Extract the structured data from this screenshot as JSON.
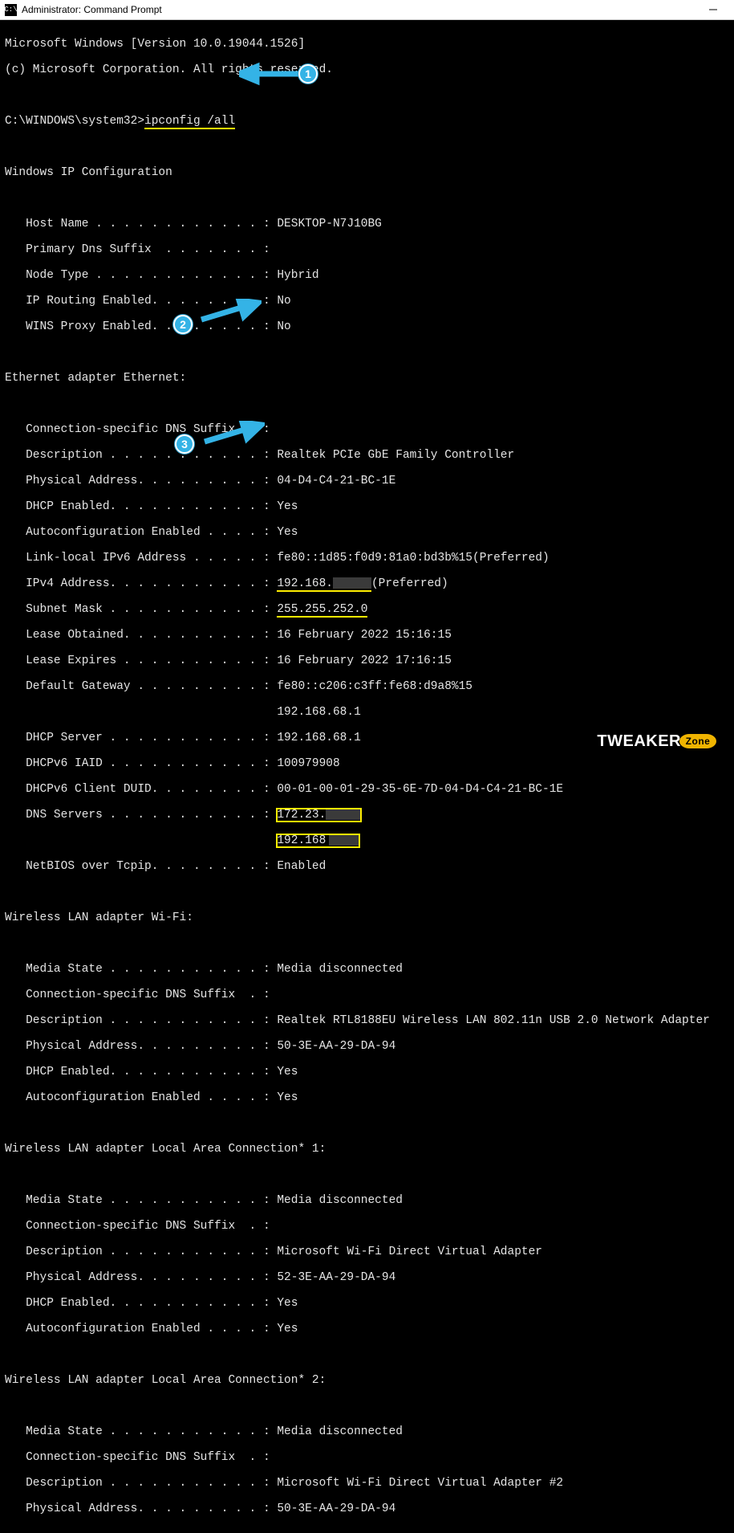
{
  "titlebar": {
    "icon_glyph": "C:\\",
    "title": "Administrator: Command Prompt"
  },
  "header": {
    "line1": "Microsoft Windows [Version 10.0.19044.1526]",
    "line2": "(c) Microsoft Corporation. All rights reserved."
  },
  "prompt": {
    "path": "C:\\WINDOWS\\system32>",
    "command": "ipconfig /all"
  },
  "ipcfg": {
    "heading": "Windows IP Configuration",
    "lines": [
      {
        "k": "   Host Name . . . . . . . . . . . . : ",
        "v": "DESKTOP-N7J10BG"
      },
      {
        "k": "   Primary Dns Suffix  . . . . . . . :",
        "v": ""
      },
      {
        "k": "   Node Type . . . . . . . . . . . . : ",
        "v": "Hybrid"
      },
      {
        "k": "   IP Routing Enabled. . . . . . . . : ",
        "v": "No"
      },
      {
        "k": "   WINS Proxy Enabled. . . . . . . . : ",
        "v": "No"
      }
    ]
  },
  "eth": {
    "heading": "Ethernet adapter Ethernet:",
    "dns_suffix": "   Connection-specific DNS Suffix  . :",
    "description_k": "   Description . . . . . . . . . . . : ",
    "description_v": "Realtek PCIe GbE Family Controller",
    "phys_k": "   Physical Address. . . . . . . . . : ",
    "phys_v": "04-D4-C4-21-BC-1E",
    "dhcp_k": "   DHCP Enabled. . . . . . . . . . . : ",
    "dhcp_v": "Yes",
    "auto_k": "   Autoconfiguration Enabled . . . . : ",
    "auto_v": "Yes",
    "linklocal_k": "   Link-local IPv6 Address . . . . . : ",
    "linklocal_v": "fe80::1d85:f0d9:81a0:bd3b%15(Preferred)",
    "ipv4_k": "   IPv4 Address. . . . . . . . . . . : ",
    "ipv4_v": "192.168.",
    "ipv4_suffix": "(Preferred)",
    "subnet_k": "   Subnet Mask . . . . . . . . . . . : ",
    "subnet_v": "255.255.252.0",
    "lease_obt_k": "   Lease Obtained. . . . . . . . . . : ",
    "lease_obt_v": "16 February 2022 15:16:15",
    "lease_exp_k": "   Lease Expires . . . . . . . . . . : ",
    "lease_exp_v": "16 February 2022 17:16:15",
    "defgw_k": "   Default Gateway . . . . . . . . . : ",
    "defgw_v1": "fe80::c206:c3ff:fe68:d9a8%15",
    "defgw_indent": "                                       ",
    "defgw_v2": "192.168.68.1",
    "dhcp_server_k": "   DHCP Server . . . . . . . . . . . : ",
    "dhcp_server_v": "192.168.68.1",
    "iaid_k": "   DHCPv6 IAID . . . . . . . . . . . : ",
    "iaid_v": "100979908",
    "duid_k": "   DHCPv6 Client DUID. . . . . . . . : ",
    "duid_v": "00-01-00-01-29-35-6E-7D-04-D4-C4-21-BC-1E",
    "dns_k": "   DNS Servers . . . . . . . . . . . : ",
    "dns_v1": "172.23.",
    "dns_indent": "                                       ",
    "dns_v2": "192.168",
    "netbios_k": "   NetBIOS over Tcpip. . . . . . . . : ",
    "netbios_v": "Enabled"
  },
  "wifi": {
    "heading": "Wireless LAN adapter Wi-Fi:",
    "media_k": "   Media State . . . . . . . . . . . : ",
    "media_v": "Media disconnected",
    "dns_suffix": "   Connection-specific DNS Suffix  . :",
    "desc_k": "   Description . . . . . . . . . . . : ",
    "desc_v": "Realtek RTL8188EU Wireless LAN 802.11n USB 2.0 Network Adapter",
    "phys_k": "   Physical Address. . . . . . . . . : ",
    "phys_v": "50-3E-AA-29-DA-94",
    "dhcp_k": "   DHCP Enabled. . . . . . . . . . . : ",
    "dhcp_v": "Yes",
    "auto_k": "   Autoconfiguration Enabled . . . . : ",
    "auto_v": "Yes"
  },
  "lac1": {
    "heading": "Wireless LAN adapter Local Area Connection* 1:",
    "media_k": "   Media State . . . . . . . . . . . : ",
    "media_v": "Media disconnected",
    "dns_suffix": "   Connection-specific DNS Suffix  . :",
    "desc_k": "   Description . . . . . . . . . . . : ",
    "desc_v": "Microsoft Wi-Fi Direct Virtual Adapter",
    "phys_k": "   Physical Address. . . . . . . . . : ",
    "phys_v": "52-3E-AA-29-DA-94",
    "dhcp_k": "   DHCP Enabled. . . . . . . . . . . : ",
    "dhcp_v": "Yes",
    "auto_k": "   Autoconfiguration Enabled . . . . : ",
    "auto_v": "Yes"
  },
  "lac2": {
    "heading": "Wireless LAN adapter Local Area Connection* 2:",
    "media_k": "   Media State . . . . . . . . . . . : ",
    "media_v": "Media disconnected",
    "dns_suffix": "   Connection-specific DNS Suffix  . :",
    "desc_k": "   Description . . . . . . . . . . . : ",
    "desc_v": "Microsoft Wi-Fi Direct Virtual Adapter #2",
    "phys_k": "   Physical Address. . . . . . . . . : ",
    "phys_v": "50-3E-AA-29-DA-94"
  },
  "annotations": {
    "b1": "1",
    "b2": "2",
    "b3": "3"
  },
  "brand": {
    "main": "TWEAKER",
    "sub": "Zone"
  }
}
